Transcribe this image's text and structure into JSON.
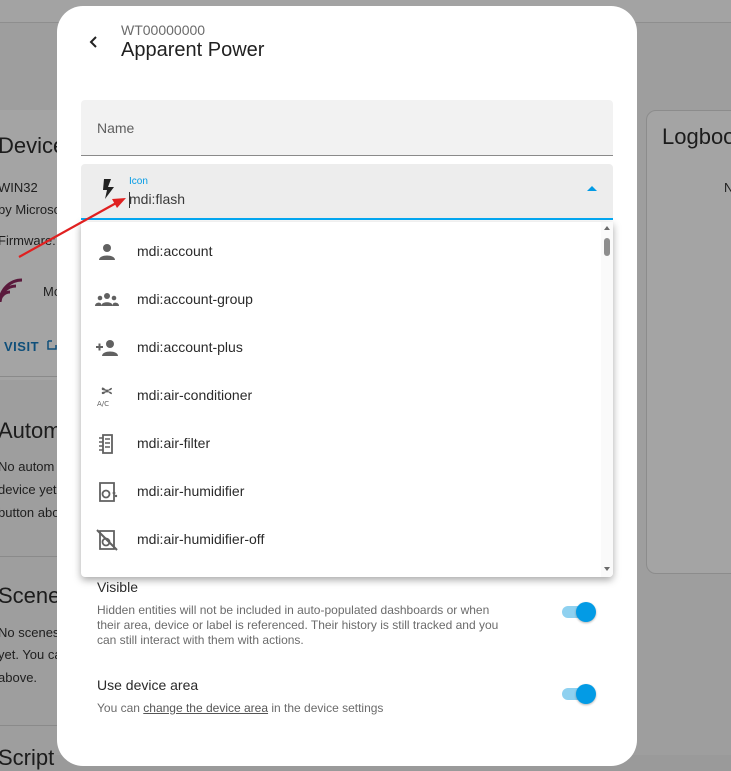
{
  "background": {
    "device_heading": "Device",
    "device_os": "WIN32",
    "device_maker": "by Microso",
    "firmware": "Firmware:",
    "device_short": "Mc",
    "visit_label": "VISIT",
    "automations_heading": "Autom",
    "automations_lines": [
      "No autom",
      "device yet",
      "button abo"
    ],
    "scenes_heading": "Scene",
    "scenes_lines": [
      "No scenes",
      "yet. You ca",
      "above."
    ],
    "scripts_heading": "Script",
    "logbook_heading": "Logboo",
    "logbook_snippet": "N"
  },
  "dialog": {
    "subtitle": "WT00000000",
    "title": "Apparent Power",
    "name_field": {
      "label": "Name"
    },
    "icon_field": {
      "label": "Icon",
      "value": "mdi:flash",
      "icon": "flash-icon"
    },
    "dropdown_items": [
      {
        "label": "mdi:account",
        "icon": "account-icon"
      },
      {
        "label": "mdi:account-group",
        "icon": "account-group-icon"
      },
      {
        "label": "mdi:account-plus",
        "icon": "account-plus-icon"
      },
      {
        "label": "mdi:air-conditioner",
        "icon": "air-conditioner-icon"
      },
      {
        "label": "mdi:air-filter",
        "icon": "air-filter-icon"
      },
      {
        "label": "mdi:air-humidifier",
        "icon": "air-humidifier-icon"
      },
      {
        "label": "mdi:air-humidifier-off",
        "icon": "air-humidifier-off-icon"
      }
    ],
    "visible": {
      "title": "Visible",
      "desc_lines": [
        "Hidden entities will not be included in auto-populated dashboards or when",
        "their area, device or label is referenced. Their history is still tracked and you",
        "can still interact with them with actions."
      ],
      "enabled": true
    },
    "device_area": {
      "title": "Use device area",
      "desc_prefix": "You can ",
      "desc_link": "change the device area",
      "desc_suffix": " in the device settings",
      "enabled": true
    }
  },
  "colors": {
    "accent": "#039be5",
    "annotation_arrow": "#e02020"
  }
}
